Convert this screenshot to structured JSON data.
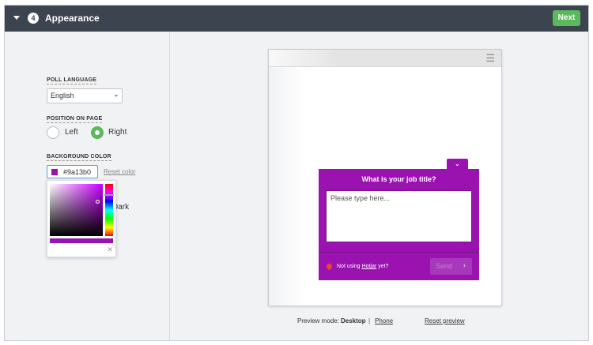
{
  "header": {
    "step_number": "4",
    "title": "Appearance",
    "next_label": "Next"
  },
  "settings": {
    "poll_language": {
      "label": "POLL LANGUAGE",
      "value": "English"
    },
    "position": {
      "label": "POSITION ON PAGE",
      "options": [
        "Left",
        "Right"
      ],
      "selected": "Right"
    },
    "background_color": {
      "label": "BACKGROUND COLOR",
      "value": "#9a13b0",
      "reset_label": "Reset color"
    },
    "skin": {
      "dark_label": "Dark"
    }
  },
  "preview": {
    "poll_question": "What is your job title?",
    "poll_placeholder": "Please type here...",
    "footer_text": "Not using",
    "footer_link": "Hotjar",
    "footer_suffix": "yet?",
    "send_label": "Send",
    "mode_label": "Preview mode:",
    "mode_desktop": "Desktop",
    "mode_separator": "|",
    "mode_phone": "Phone",
    "reset_preview_label": "Reset preview"
  },
  "colors": {
    "poll_bg": "#9a13b0",
    "header_bg": "#3c4450",
    "accent_green": "#5cb85c"
  },
  "icons": {
    "collapse": "caret-down-icon",
    "menu": "hamburger-icon",
    "tab_toggle": "chevron-down-icon",
    "send": "chevron-right-icon",
    "close": "close-icon",
    "brand": "hotjar-icon"
  }
}
